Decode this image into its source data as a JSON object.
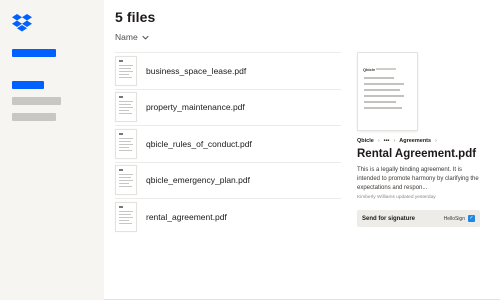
{
  "colors": {
    "accent": "#0061fe",
    "muted": "#c9c7c4",
    "sidebar_bg": "#f7f5f2"
  },
  "sidebar": {
    "logo_icon": "dropbox-logo",
    "items": [
      {
        "state": "active"
      },
      {
        "state": "active"
      },
      {
        "state": "inactive"
      },
      {
        "state": "inactive"
      }
    ]
  },
  "main": {
    "title": "5 files",
    "sort_label": "Name",
    "sort_icon": "chevron-down-icon",
    "files": [
      {
        "name": "business_space_lease.pdf"
      },
      {
        "name": "property_maintenance.pdf"
      },
      {
        "name": "qbicle_rules_of_conduct.pdf"
      },
      {
        "name": "qbicle_emergency_plan.pdf"
      },
      {
        "name": "rental_agreement.pdf"
      }
    ]
  },
  "preview": {
    "thumb_brand": "Qbicle",
    "breadcrumb": [
      "Qbicle",
      "•••",
      "Agreements"
    ],
    "title": "Rental Agreement.pdf",
    "description": "This is a legally binding agreement. It is intended to promote harmony by clarifying the expectations and respon...",
    "meta": "Kimberly Williams updated yesterday",
    "action_label": "Send for signature",
    "action_provider": "HelloSign",
    "action_icon": "hellosign-icon"
  }
}
